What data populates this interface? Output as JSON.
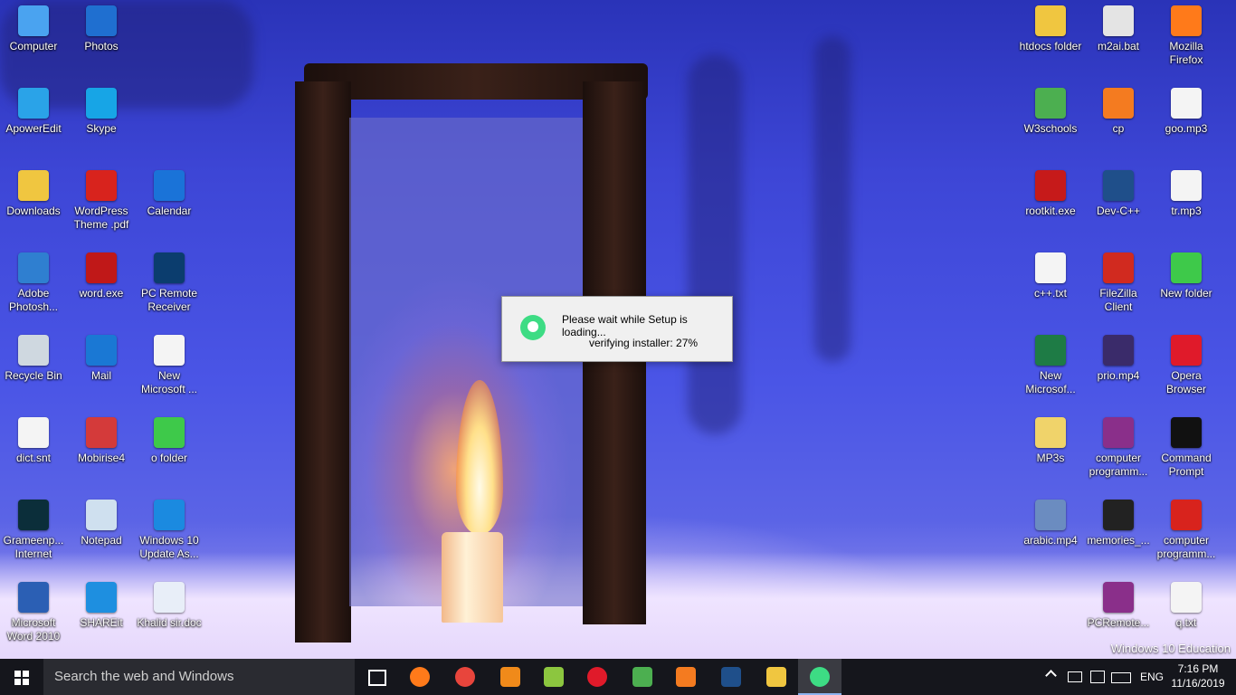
{
  "left_icons": [
    {
      "label": "Computer",
      "icon": "computer-icon",
      "color": "#4aa3f0"
    },
    {
      "label": "Photos",
      "icon": "photos-icon",
      "color": "#1f6fd0"
    },
    {
      "label": "ApowerEdit",
      "icon": "apoweredit-icon",
      "color": "#2aa3e8"
    },
    {
      "label": "Skype",
      "icon": "skype-icon",
      "color": "#17a5e6"
    },
    {
      "label": "Downloads",
      "icon": "downloads-folder-icon",
      "color": "#f0c640"
    },
    {
      "label": "WordPress Theme .pdf",
      "icon": "pdf-icon",
      "color": "#d8231d"
    },
    {
      "label": "Calendar",
      "icon": "calendar-icon",
      "color": "#1a73d8"
    },
    {
      "label": "Adobe Photosh...",
      "icon": "photoshop-icon",
      "color": "#2f7fd0"
    },
    {
      "label": "word.exe",
      "icon": "word-exe-icon",
      "color": "#c01818"
    },
    {
      "label": "PC Remote Receiver",
      "icon": "pc-remote-icon",
      "color": "#0b3d6e"
    },
    {
      "label": "Recycle Bin",
      "icon": "recycle-bin-icon",
      "color": "#cfd8e0"
    },
    {
      "label": "Mail",
      "icon": "mail-icon",
      "color": "#1a78d4"
    },
    {
      "label": "New Microsoft ...",
      "icon": "document-icon",
      "color": "#f4f4f4"
    },
    {
      "label": "dict.snt",
      "icon": "file-icon",
      "color": "#f4f4f4"
    },
    {
      "label": "Mobirise4",
      "icon": "mobirise-icon",
      "color": "#d43a3a"
    },
    {
      "label": "o folder",
      "icon": "folder-icon",
      "color": "#3ec94a"
    },
    {
      "label": "Grameenp... Internet",
      "icon": "grameenphone-icon",
      "color": "#0b2e3a"
    },
    {
      "label": "Notepad",
      "icon": "notepad-icon",
      "color": "#cfe0ef"
    },
    {
      "label": "Windows 10 Update As...",
      "icon": "windows-update-icon",
      "color": "#1b8ae0"
    },
    {
      "label": "Microsoft Word 2010",
      "icon": "word-icon",
      "color": "#2b5fb4"
    },
    {
      "label": "SHAREit",
      "icon": "shareit-icon",
      "color": "#1e8fe0"
    },
    {
      "label": "Khalid sir.doc",
      "icon": "word-doc-icon",
      "color": "#e8eef8"
    }
  ],
  "right_icons": [
    {
      "label": "htdocs folder",
      "icon": "folder-icon",
      "color": "#f0c640"
    },
    {
      "label": "m2ai.bat",
      "icon": "batch-file-icon",
      "color": "#e4e4e4"
    },
    {
      "label": "Mozilla Firefox",
      "icon": "firefox-icon",
      "color": "#ff7a1a"
    },
    {
      "label": "W3schools",
      "icon": "w3schools-icon",
      "color": "#4caf50"
    },
    {
      "label": "cp",
      "icon": "xampp-icon",
      "color": "#f47b20"
    },
    {
      "label": "goo.mp3",
      "icon": "mp3-icon",
      "color": "#f4f4f4"
    },
    {
      "label": "rootkit.exe",
      "icon": "rootkit-icon",
      "color": "#c61a1a"
    },
    {
      "label": "Dev-C++",
      "icon": "devcpp-icon",
      "color": "#1f4f8a"
    },
    {
      "label": "tr.mp3",
      "icon": "mp3-icon",
      "color": "#f4f4f4"
    },
    {
      "label": "c++.txt",
      "icon": "text-file-icon",
      "color": "#f4f4f4"
    },
    {
      "label": "FileZilla Client",
      "icon": "filezilla-icon",
      "color": "#d12a1f"
    },
    {
      "label": "New folder",
      "icon": "folder-icon",
      "color": "#3ec94a"
    },
    {
      "label": "New Microsof...",
      "icon": "excel-icon",
      "color": "#1e7b45"
    },
    {
      "label": "prio.mp4",
      "icon": "video-icon",
      "color": "#3a2b6a"
    },
    {
      "label": "Opera Browser",
      "icon": "opera-icon",
      "color": "#e01a2a"
    },
    {
      "label": "MP3s",
      "icon": "mp3-folder-icon",
      "color": "#f0d36a"
    },
    {
      "label": "computer programm...",
      "icon": "winrar-icon",
      "color": "#8a2f8a"
    },
    {
      "label": "Command Prompt",
      "icon": "cmd-icon",
      "color": "#111111"
    },
    {
      "label": "arabic.mp4",
      "icon": "video-icon",
      "color": "#6b8cc0"
    },
    {
      "label": "memories_...",
      "icon": "video-icon",
      "color": "#222222"
    },
    {
      "label": "computer programm...",
      "icon": "pdf-icon",
      "color": "#d8231d"
    },
    {
      "label": "PCRemote...",
      "icon": "winrar-icon",
      "color": "#8a2f8a"
    },
    {
      "label": "q.txt",
      "icon": "text-file-icon",
      "color": "#f4f4f4"
    }
  ],
  "dialog": {
    "line1": "Please wait while Setup is loading...",
    "line2": "verifying installer: 27%",
    "progress_percent": 27
  },
  "watermark": "Windows 10 Education",
  "taskbar": {
    "search_placeholder": "Search the web and Windows",
    "apps": [
      {
        "icon": "task-view-icon",
        "color": "#ffffff"
      },
      {
        "icon": "firefox-icon",
        "color": "#ff7a1a"
      },
      {
        "icon": "chrome-icon",
        "color": "#e8453c"
      },
      {
        "icon": "sublime-text-icon",
        "color": "#f08a1a"
      },
      {
        "icon": "notepad-plus-icon",
        "color": "#8cc63f"
      },
      {
        "icon": "opera-icon",
        "color": "#e01a2a"
      },
      {
        "icon": "w3schools-icon",
        "color": "#4caf50"
      },
      {
        "icon": "xampp-icon",
        "color": "#f47b20"
      },
      {
        "icon": "devcpp-icon",
        "color": "#1f4f8a"
      },
      {
        "icon": "file-explorer-icon",
        "color": "#f0c640"
      },
      {
        "icon": "android-studio-setup-icon",
        "color": "#3ddc84"
      }
    ],
    "language": "ENG",
    "time": "7:16 PM",
    "date": "11/16/2019"
  }
}
